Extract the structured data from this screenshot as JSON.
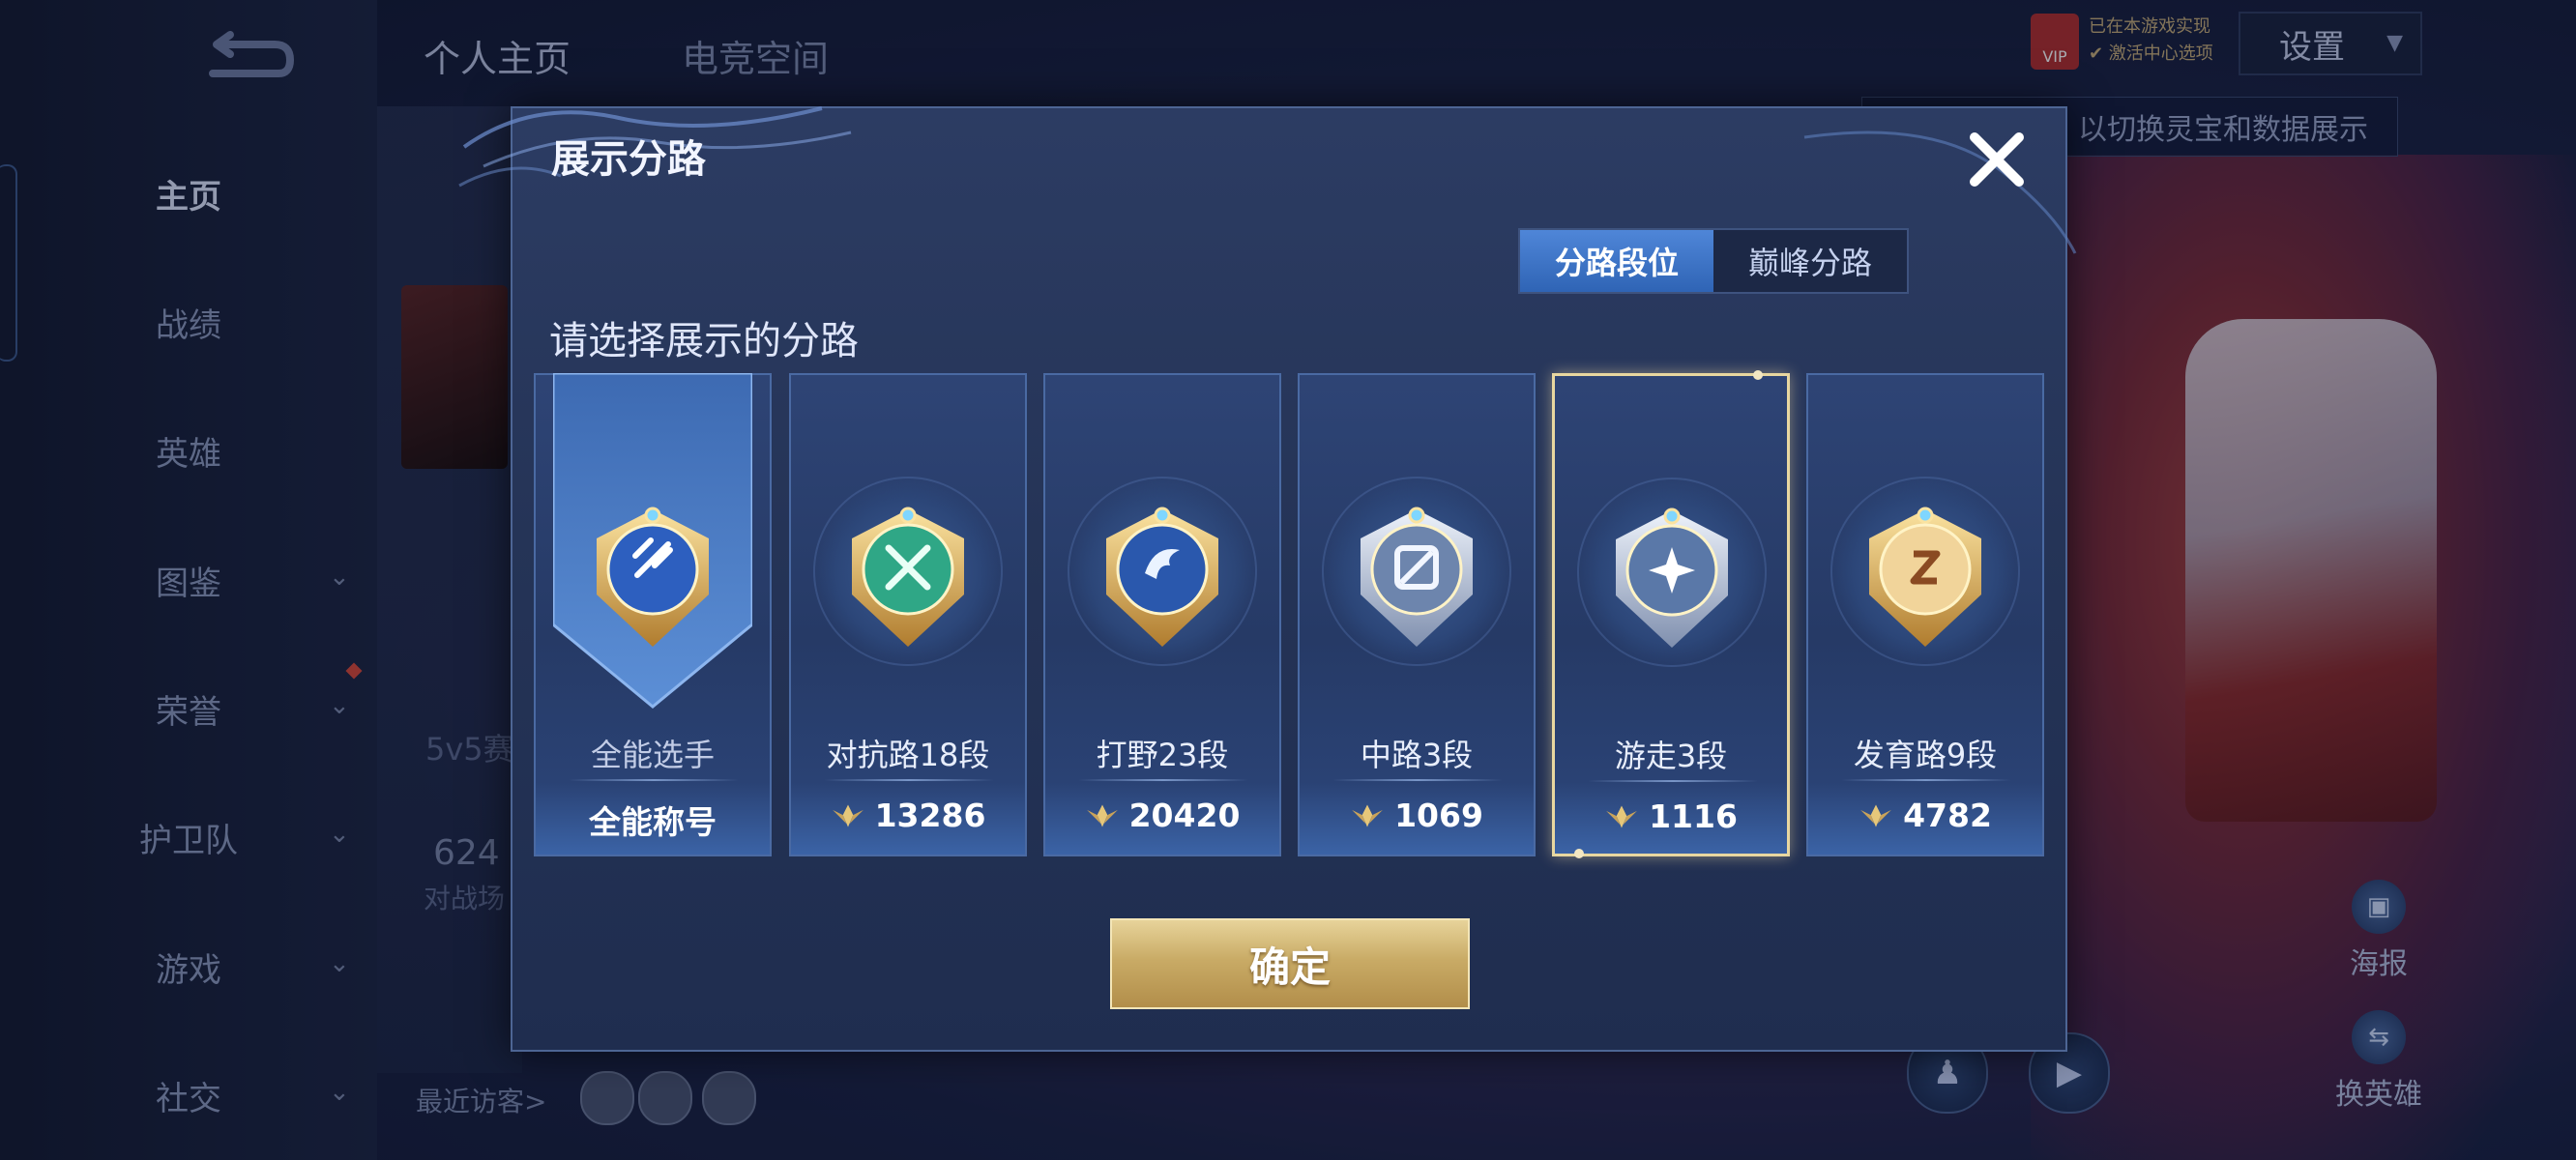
{
  "sidebar": {
    "items": [
      {
        "label": "主页",
        "has_chevron": false,
        "active": true
      },
      {
        "label": "战绩",
        "has_chevron": false,
        "active": false
      },
      {
        "label": "英雄",
        "has_chevron": false,
        "active": false
      },
      {
        "label": "图鉴",
        "has_chevron": true,
        "active": false
      },
      {
        "label": "荣誉",
        "has_chevron": true,
        "active": false
      },
      {
        "label": "护卫队",
        "has_chevron": true,
        "active": false
      },
      {
        "label": "游戏",
        "has_chevron": true,
        "active": false
      },
      {
        "label": "社交",
        "has_chevron": true,
        "active": false
      }
    ]
  },
  "background": {
    "tabs": [
      "个人主页",
      "电竞空间"
    ],
    "season_text": "5v5赛",
    "count_text": "624",
    "count_caption": "对战场",
    "recent_visitors": "最近访客>",
    "settings_label": "设置",
    "vip_label": "VIP",
    "vip_line1": "已在本游戏实现",
    "vip_line2": "✔ 激活中心选项",
    "hint_strip": "以切换灵宝和数据展示",
    "right_buttons": [
      "海报",
      "换英雄"
    ]
  },
  "modal": {
    "title": "展示分路",
    "segments": [
      {
        "label": "分路段位",
        "active": true
      },
      {
        "label": "巅峰分路",
        "active": false
      }
    ],
    "prompt": "请选择展示的分路",
    "cards": [
      {
        "name": "全能选手",
        "value": "全能称号",
        "badge": "allround-badge-icon",
        "selected": false,
        "banner": true
      },
      {
        "name": "对抗路18段",
        "value": "13286",
        "badge": "clash-lane-badge-icon",
        "selected": false,
        "banner": false
      },
      {
        "name": "打野23段",
        "value": "20420",
        "badge": "jungle-badge-icon",
        "selected": false,
        "banner": false
      },
      {
        "name": "中路3段",
        "value": "1069",
        "badge": "mid-lane-badge-icon",
        "selected": false,
        "banner": false
      },
      {
        "name": "游走3段",
        "value": "1116",
        "badge": "roam-badge-icon",
        "selected": true,
        "banner": false
      },
      {
        "name": "发育路9段",
        "value": "4782",
        "badge": "farm-lane-badge-icon",
        "selected": false,
        "banner": false
      }
    ],
    "confirm_label": "确定"
  },
  "colors": {
    "segment_active": "#3f76c9",
    "confirm_gold": "#c9ab66",
    "selected_border": "#e8d7a0"
  }
}
